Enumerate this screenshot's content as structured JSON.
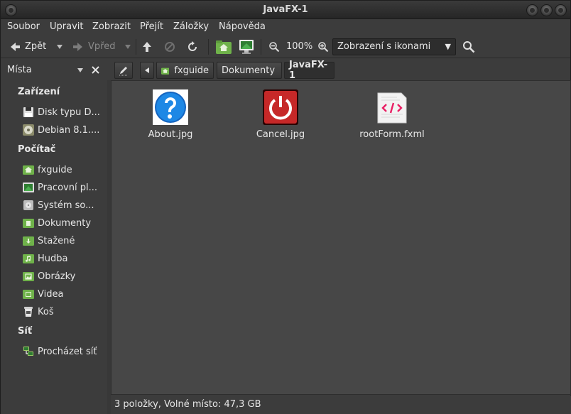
{
  "window": {
    "title": "JavaFX-1"
  },
  "menu": [
    "Soubor",
    "Upravit",
    "Zobrazit",
    "Přejít",
    "Záložky",
    "Nápověda"
  ],
  "toolbar": {
    "back_label": "Zpět",
    "forward_label": "Vpřed",
    "zoom_level": "100%",
    "view_mode": "Zobrazení s ikonami"
  },
  "sidebar": {
    "title": "Místa",
    "sections": {
      "devices": "Zařízení",
      "computer": "Počítač",
      "network": "Síť"
    },
    "devices": [
      "Disk typu D...",
      "Debian 8.1...."
    ],
    "computer": [
      "fxguide",
      "Pracovní pl...",
      "Systém so...",
      "Dokumenty",
      "Stažené",
      "Hudba",
      "Obrázky",
      "Videa",
      "Koš"
    ],
    "network": [
      "Procházet síť"
    ]
  },
  "path": [
    "fxguide",
    "Dokumenty",
    "JavaFX-1"
  ],
  "files": [
    {
      "name": "About.jpg"
    },
    {
      "name": "Cancel.jpg"
    },
    {
      "name": "rootForm.fxml"
    }
  ],
  "status": "3 položky, Volné místo: 47,3 GB",
  "colors": {
    "folder_green": "#6fb24a",
    "background": "#474747"
  }
}
